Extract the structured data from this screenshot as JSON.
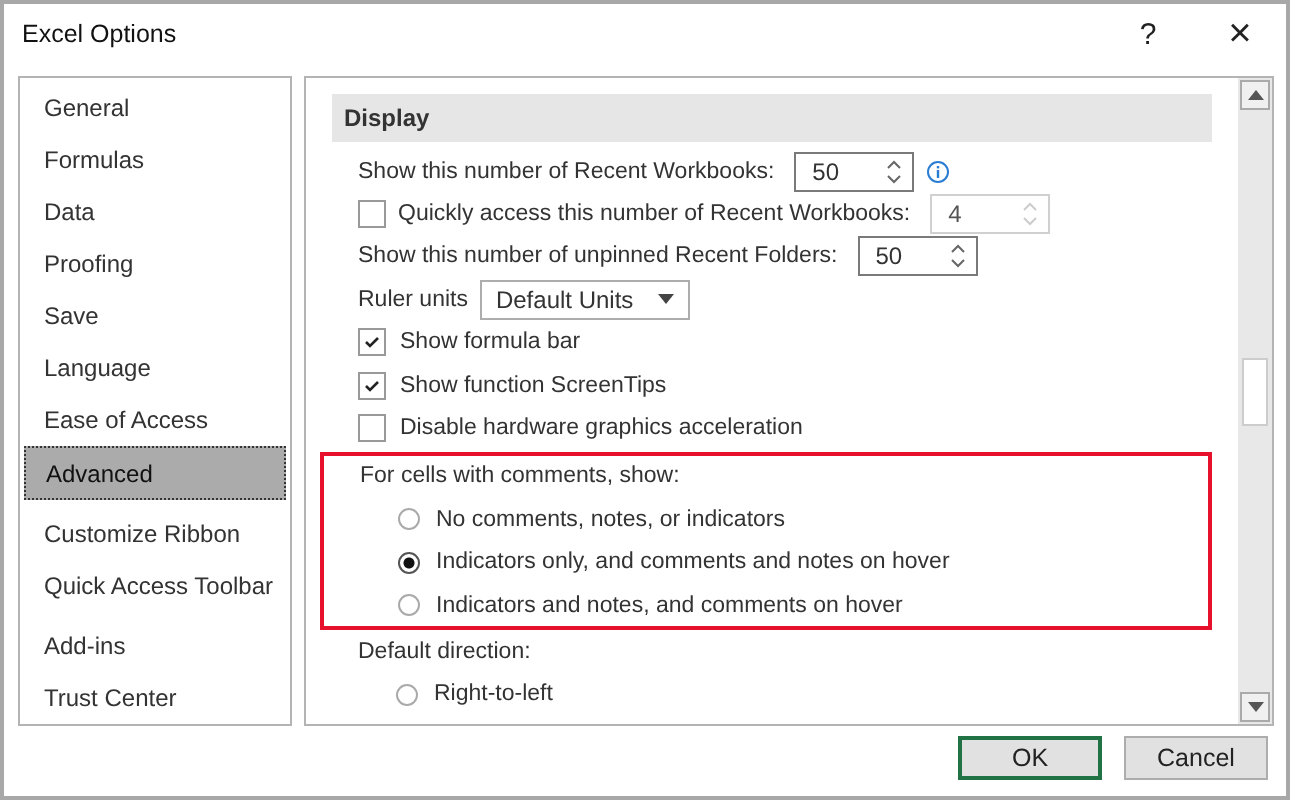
{
  "window": {
    "title": "Excel Options",
    "help": "?",
    "close": "×"
  },
  "sidebar": {
    "groups": [
      [
        {
          "label": "General",
          "selected": false
        },
        {
          "label": "Formulas",
          "selected": false
        },
        {
          "label": "Data",
          "selected": false
        },
        {
          "label": "Proofing",
          "selected": false
        },
        {
          "label": "Save",
          "selected": false
        },
        {
          "label": "Language",
          "selected": false
        },
        {
          "label": "Ease of Access",
          "selected": false
        },
        {
          "label": "Advanced",
          "selected": true
        }
      ],
      [
        {
          "label": "Customize Ribbon",
          "selected": false
        },
        {
          "label": "Quick Access Toolbar",
          "selected": false
        }
      ],
      [
        {
          "label": "Add-ins",
          "selected": false
        },
        {
          "label": "Trust Center",
          "selected": false
        }
      ]
    ]
  },
  "section": {
    "title": "Display"
  },
  "rows": [
    {
      "kind": "spinner",
      "label": "Show this number of Recent Workbooks:",
      "value": "50",
      "info": true,
      "disabled": false
    },
    {
      "kind": "check_spinner",
      "label": "Quickly access this number of Recent Workbooks:",
      "checked": false,
      "value": "4",
      "disabled": true
    },
    {
      "kind": "spinner",
      "label": "Show this number of unpinned Recent Folders:",
      "value": "50",
      "info": false,
      "disabled": false
    },
    {
      "kind": "dropdown",
      "label": "Ruler units",
      "value": "Default Units"
    },
    {
      "kind": "checkbox",
      "label": "Show formula bar",
      "checked": true
    },
    {
      "kind": "checkbox",
      "label": "Show function ScreenTips",
      "checked": true
    },
    {
      "kind": "checkbox",
      "label": "Disable hardware graphics acceleration",
      "checked": false
    },
    {
      "kind": "radio_group",
      "label": "For cells with comments, show:",
      "highlighted": true,
      "options": [
        {
          "label": "No comments, notes, or indicators",
          "selected": false
        },
        {
          "label": "Indicators only, and comments and notes on hover",
          "selected": true
        },
        {
          "label": "Indicators and notes, and comments on hover",
          "selected": false
        }
      ]
    },
    {
      "kind": "radio_group",
      "label": "Default direction:",
      "highlighted": false,
      "options": [
        {
          "label": "Right-to-left",
          "selected": false
        }
      ]
    }
  ],
  "buttons": [
    {
      "label": "OK",
      "default": true
    },
    {
      "label": "Cancel",
      "default": false
    }
  ]
}
